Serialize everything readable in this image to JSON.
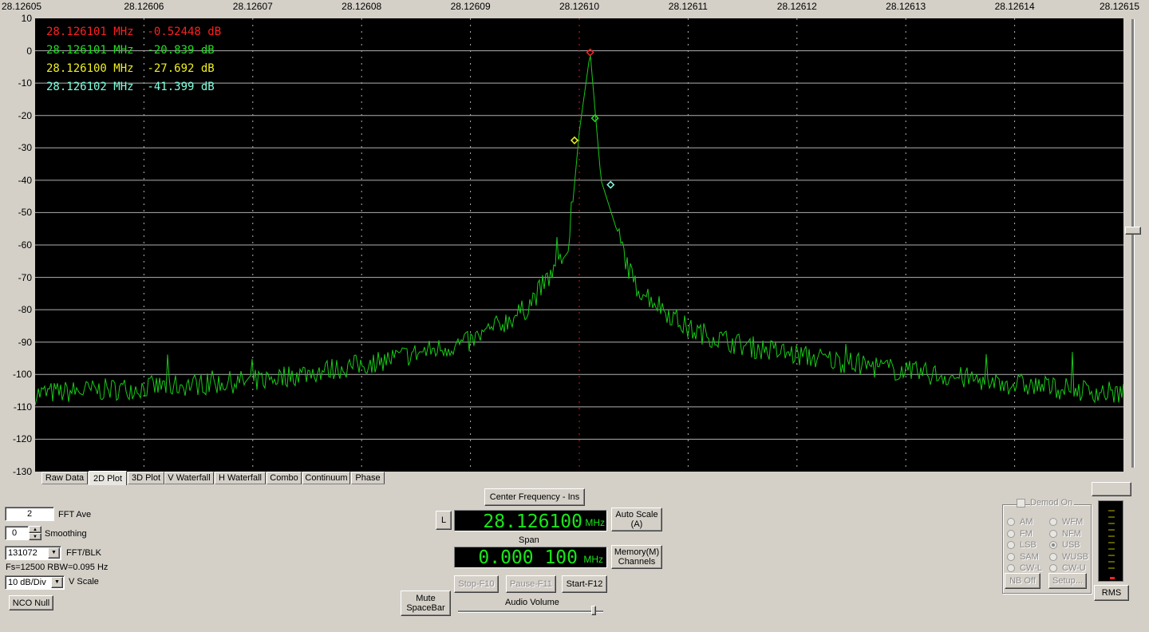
{
  "plot": {
    "x_ticks": [
      "28.12605",
      "28.12606",
      "28.12607",
      "28.12608",
      "28.12609",
      "28.12610",
      "28.12611",
      "28.12612",
      "28.12613",
      "28.12614",
      "28.12615"
    ],
    "y_ticks": [
      "10",
      "0",
      "-10",
      "-20",
      "-30",
      "-40",
      "-50",
      "-60",
      "-70",
      "-80",
      "-90",
      "-100",
      "-110",
      "-120",
      "-130"
    ],
    "markers": [
      {
        "text": "28.126101 MHz  -0.52448 dB",
        "color": "#ff2020"
      },
      {
        "text": "28.126101 MHz  -20.839 dB",
        "color": "#20e020"
      },
      {
        "text": "28.126100 MHz  -27.692 dB",
        "color": "#f0f020"
      },
      {
        "text": "28.126102 MHz  -41.399 dB",
        "color": "#80ffe0"
      }
    ],
    "trace_color": "#18c818"
  },
  "chart_data": {
    "type": "line",
    "title": "",
    "xlabel": "",
    "ylabel": "",
    "xlim": [
      28.12605,
      28.12615
    ],
    "ylim": [
      -130,
      10
    ],
    "x": [
      28.12605,
      28.12606,
      28.12607,
      28.12608,
      28.12609,
      28.126095,
      28.126099,
      28.1261,
      28.126101,
      28.126102,
      28.126105,
      28.12611,
      28.126115,
      28.12612,
      28.12613,
      28.12614,
      28.12615
    ],
    "y": [
      -106,
      -104,
      -102,
      -97,
      -90,
      -80,
      -62,
      -25,
      -0.52,
      -40,
      -72,
      -86,
      -91,
      -94,
      -99,
      -103,
      -106
    ],
    "marker_points": [
      {
        "x": 28.126101,
        "y": -0.52448,
        "color": "#ff2020"
      },
      {
        "x": 28.126101,
        "y": -20.839,
        "color": "#20e020"
      },
      {
        "x": 28.1261,
        "y": -27.692,
        "color": "#f0f020"
      },
      {
        "x": 28.126102,
        "y": -41.399,
        "color": "#80ffe0"
      }
    ],
    "grid": true
  },
  "tabs": [
    "Raw Data",
    "2D Plot",
    "3D Plot",
    "V Waterfall",
    "H Waterfall",
    "Combo",
    "Continuum",
    "Phase"
  ],
  "active_tab": "2D Plot",
  "left": {
    "fft_ave_value": "2",
    "fft_ave_label": "FFT Ave",
    "smoothing_value": "0",
    "smoothing_label": "Smoothing",
    "fft_blk_value": "131072",
    "fft_blk_label": "FFT/BLK",
    "info": "Fs=12500 RBW=0.095 Hz",
    "vscale_value": "10 dB/Div",
    "vscale_label": "V Scale",
    "nco_null": "NCO Null"
  },
  "center": {
    "center_freq_btn": "Center Frequency - Ins",
    "l_btn": "L",
    "freq_value": "28.126100",
    "freq_unit": "MHz",
    "auto_scale_line1": "Auto Scale",
    "auto_scale_line2": "(A)",
    "span_label": "Span",
    "span_value": "0.000 100",
    "span_unit": "MHz",
    "memory_line1": "Memory(M)",
    "memory_line2": "Channels",
    "stop": "Stop-F10",
    "pause": "Pause-F11",
    "start": "Start-F12",
    "mute_line1": "Mute",
    "mute_line2": "SpaceBar",
    "audio_volume": "Audio Volume"
  },
  "demod": {
    "demod_on": "Demod On",
    "modes_left": [
      "AM",
      "FM",
      "LSB",
      "SAM",
      "CW-L"
    ],
    "modes_right": [
      "WFM",
      "NFM",
      "USB",
      "WUSB",
      "CW-U"
    ],
    "selected": "USB",
    "nb_off": "NB Off",
    "setup": "Setup...",
    "rms": "RMS"
  }
}
